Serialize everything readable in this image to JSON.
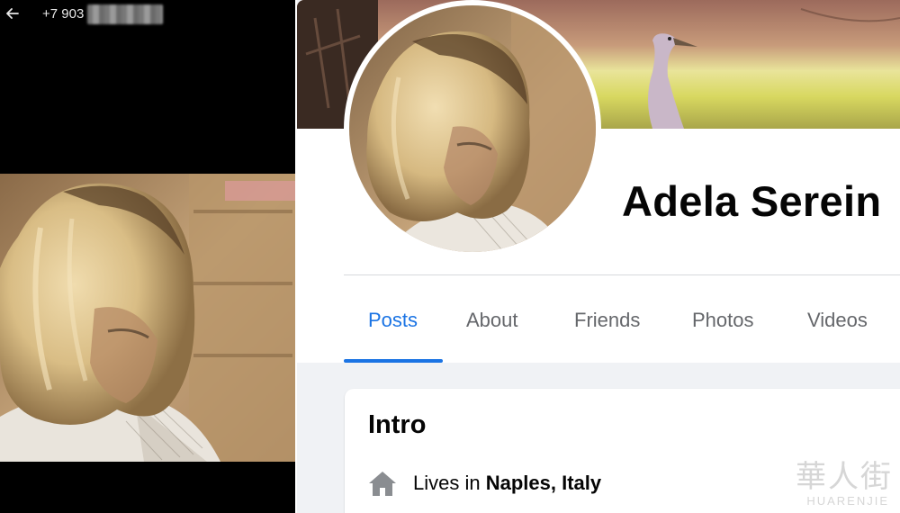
{
  "viewer": {
    "phone_number": "+7 903",
    "back_icon": "arrow-left-icon"
  },
  "profile": {
    "name": "Adela Serein",
    "tabs": [
      {
        "label": "Posts",
        "active": true
      },
      {
        "label": "About",
        "active": false
      },
      {
        "label": "Friends",
        "active": false
      },
      {
        "label": "Photos",
        "active": false
      },
      {
        "label": "Videos",
        "active": false
      }
    ],
    "intro": {
      "title": "Intro",
      "lives_prefix": "Lives in",
      "lives_place": "Naples, Italy",
      "icon": "home-icon"
    }
  },
  "watermark": {
    "chinese": "華人街",
    "latin": "HUARENJIE"
  },
  "colors": {
    "accent": "#1b74e4",
    "tab_inactive": "#65676b",
    "text": "#050505",
    "page_bg": "#f0f2f5"
  }
}
